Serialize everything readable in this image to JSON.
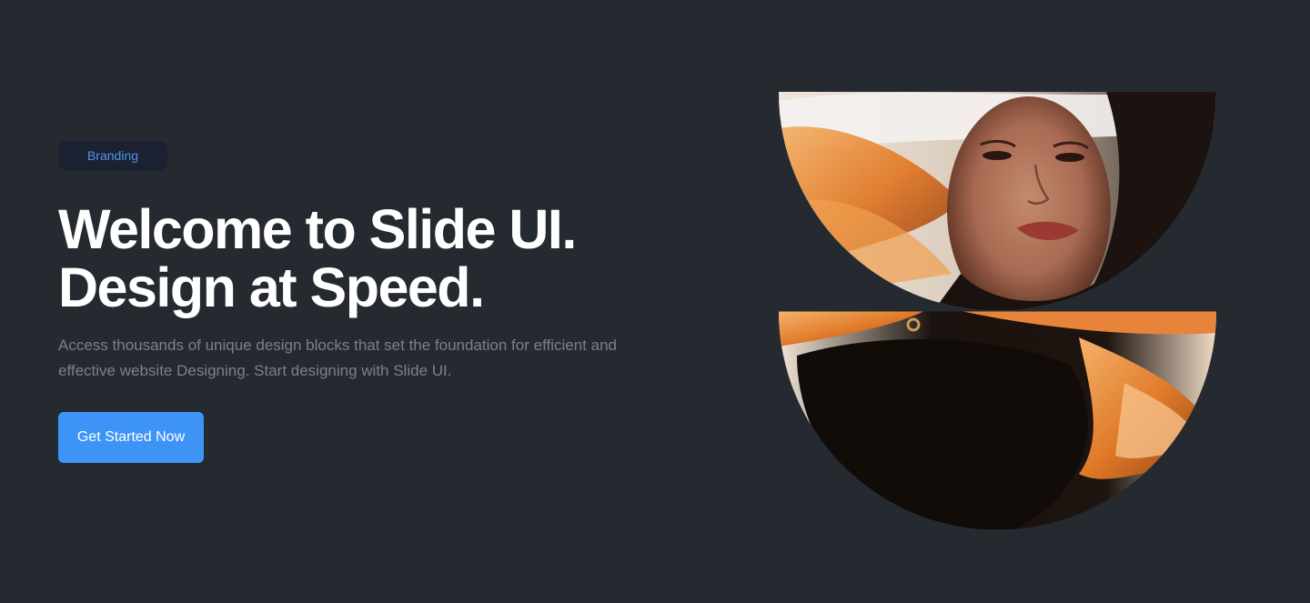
{
  "hero": {
    "badge": "Branding",
    "headline_line1": "Welcome to Slide UI.",
    "headline_line2": "Design at Speed.",
    "subtext": "Access thousands of unique design blocks that set the foundation for efficient and effective website Designing. Start designing with Slide UI.",
    "cta_label": "Get Started Now"
  },
  "colors": {
    "background": "#242a30",
    "accent": "#3d94f6",
    "badge_text": "#4f94ea",
    "muted_text": "#7a818a"
  },
  "art": {
    "top_image": "portrait-top-half",
    "bottom_image": "portrait-bottom-half"
  }
}
